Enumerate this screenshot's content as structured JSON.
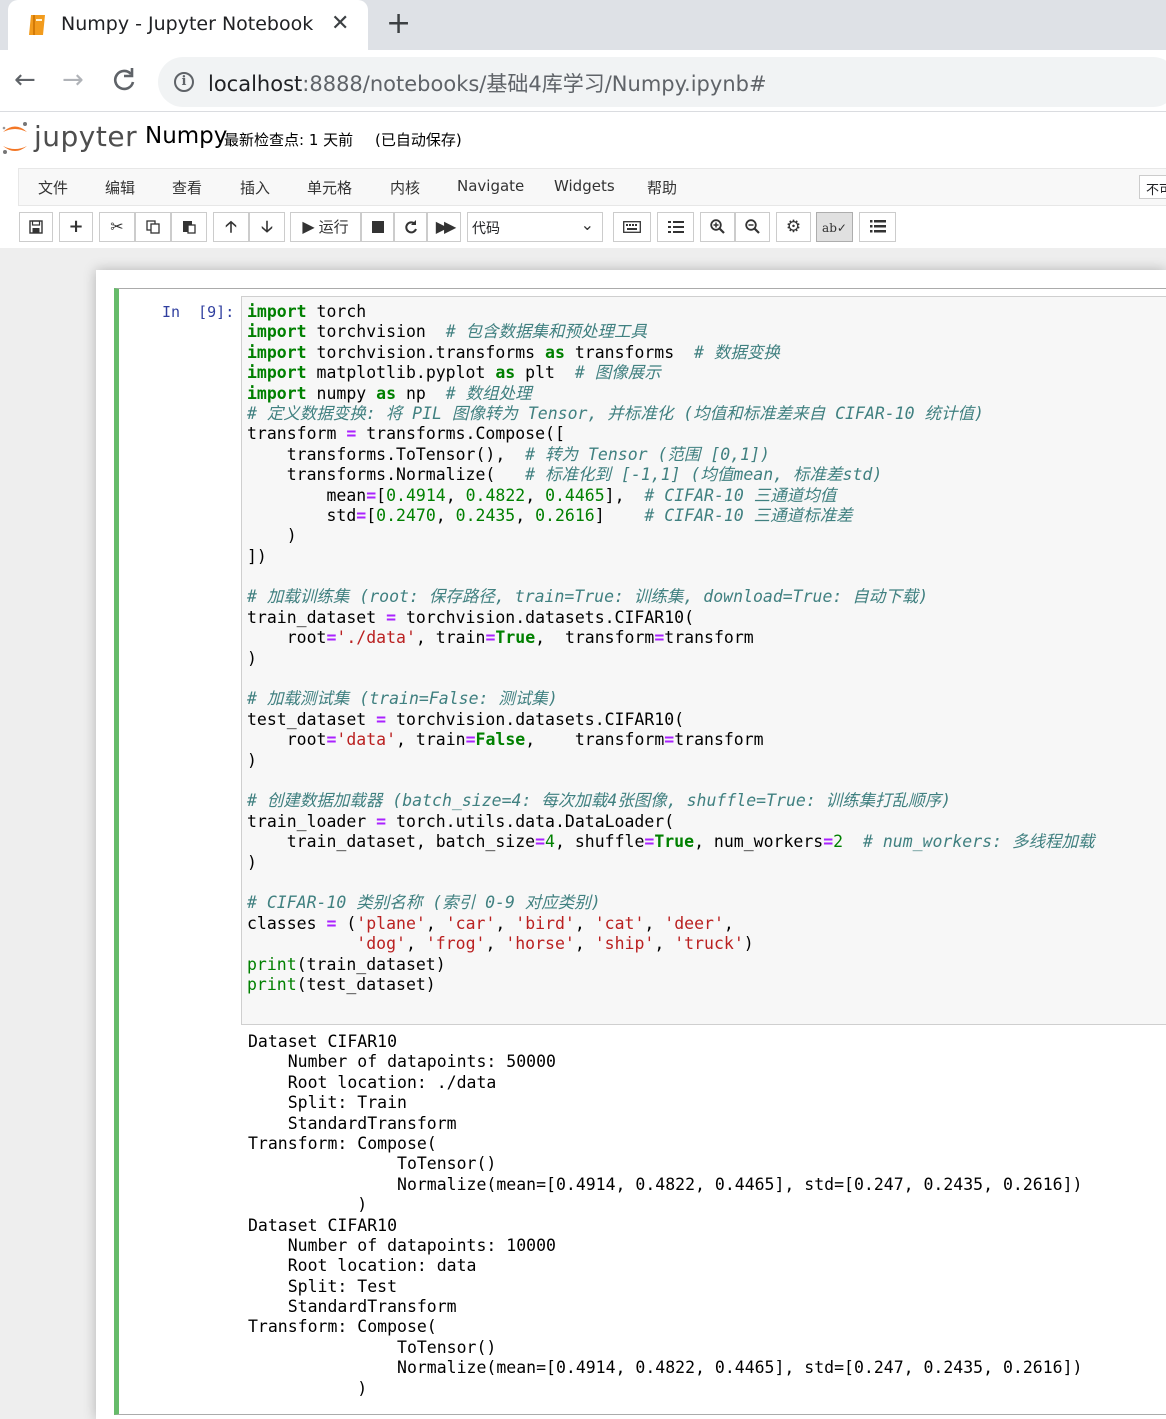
{
  "browser": {
    "tab_title": "Numpy - Jupyter Notebook",
    "close_glyph": "✕",
    "newtab_glyph": "+",
    "url_host": "localhost",
    "url_rest": ":8888/notebooks/基础4库学习/Numpy.ipynb#"
  },
  "jupyter": {
    "wordmark": "jupyter",
    "notebook_name": "Numpy",
    "checkpoint": "最新检查点: 1 天前",
    "autosave": "(已自动保存)",
    "menu": [
      "文件",
      "编辑",
      "查看",
      "插入",
      "单元格",
      "内核",
      "Navigate",
      "Widgets",
      "帮助"
    ],
    "kernel_indicator": "不可",
    "toolbar": {
      "run_label": "运行",
      "cell_type": "代码"
    }
  },
  "cell": {
    "prompt": "In  [9]:",
    "code_lines": [
      [
        [
          "kw",
          "import"
        ],
        [
          "pl",
          " torch"
        ]
      ],
      [
        [
          "kw",
          "import"
        ],
        [
          "pl",
          " torchvision  "
        ],
        [
          "cm",
          "# 包含数据集和预处理工具"
        ]
      ],
      [
        [
          "kw",
          "import"
        ],
        [
          "pl",
          " torchvision.transforms "
        ],
        [
          "kw",
          "as"
        ],
        [
          "pl",
          " transforms  "
        ],
        [
          "cm",
          "# 数据变换"
        ]
      ],
      [
        [
          "kw",
          "import"
        ],
        [
          "pl",
          " matplotlib.pyplot "
        ],
        [
          "kw",
          "as"
        ],
        [
          "pl",
          " plt  "
        ],
        [
          "cm",
          "# 图像展示"
        ]
      ],
      [
        [
          "kw",
          "import"
        ],
        [
          "pl",
          " numpy "
        ],
        [
          "kw",
          "as"
        ],
        [
          "pl",
          " np  "
        ],
        [
          "cm",
          "# 数组处理"
        ]
      ],
      [
        [
          "cm",
          "# 定义数据变换: 将 PIL 图像转为 Tensor, 并标准化 (均值和标准差来自 CIFAR-10 统计值)"
        ]
      ],
      [
        [
          "pl",
          "transform "
        ],
        [
          "op",
          "="
        ],
        [
          "pl",
          " transforms.Compose(["
        ]
      ],
      [
        [
          "pl",
          "    transforms.ToTensor(),  "
        ],
        [
          "cm",
          "# 转为 Tensor (范围 [0,1])"
        ]
      ],
      [
        [
          "pl",
          "    transforms.Normalize(   "
        ],
        [
          "cm",
          "# 标准化到 [-1,1] (均值mean, 标准差std)"
        ]
      ],
      [
        [
          "pl",
          "        mean"
        ],
        [
          "op",
          "="
        ],
        [
          "pl",
          "["
        ],
        [
          "nm",
          "0.4914"
        ],
        [
          "pl",
          ", "
        ],
        [
          "nm",
          "0.4822"
        ],
        [
          "pl",
          ", "
        ],
        [
          "nm",
          "0.4465"
        ],
        [
          "pl",
          "],  "
        ],
        [
          "cm",
          "# CIFAR-10 三通道均值"
        ]
      ],
      [
        [
          "pl",
          "        std"
        ],
        [
          "op",
          "="
        ],
        [
          "pl",
          "["
        ],
        [
          "nm",
          "0.2470"
        ],
        [
          "pl",
          ", "
        ],
        [
          "nm",
          "0.2435"
        ],
        [
          "pl",
          ", "
        ],
        [
          "nm",
          "0.2616"
        ],
        [
          "pl",
          "]    "
        ],
        [
          "cm",
          "# CIFAR-10 三通道标准差"
        ]
      ],
      [
        [
          "pl",
          "    )"
        ]
      ],
      [
        [
          "pl",
          "])"
        ]
      ],
      [
        [
          "pl",
          ""
        ]
      ],
      [
        [
          "cm",
          "# 加载训练集 (root: 保存路径, train=True: 训练集, download=True: 自动下载)"
        ]
      ],
      [
        [
          "pl",
          "train_dataset "
        ],
        [
          "op",
          "="
        ],
        [
          "pl",
          " torchvision.datasets.CIFAR10("
        ]
      ],
      [
        [
          "pl",
          "    root"
        ],
        [
          "op",
          "="
        ],
        [
          "st",
          "'./data'"
        ],
        [
          "pl",
          ", train"
        ],
        [
          "op",
          "="
        ],
        [
          "kw",
          "True"
        ],
        [
          "pl",
          ",  transform"
        ],
        [
          "op",
          "="
        ],
        [
          "pl",
          "transform"
        ]
      ],
      [
        [
          "pl",
          ")"
        ]
      ],
      [
        [
          "pl",
          ""
        ]
      ],
      [
        [
          "cm",
          "# 加载测试集 (train=False: 测试集)"
        ]
      ],
      [
        [
          "pl",
          "test_dataset "
        ],
        [
          "op",
          "="
        ],
        [
          "pl",
          " torchvision.datasets.CIFAR10("
        ]
      ],
      [
        [
          "pl",
          "    root"
        ],
        [
          "op",
          "="
        ],
        [
          "st",
          "'data'"
        ],
        [
          "pl",
          ", train"
        ],
        [
          "op",
          "="
        ],
        [
          "kw",
          "False"
        ],
        [
          "pl",
          ",    transform"
        ],
        [
          "op",
          "="
        ],
        [
          "pl",
          "transform"
        ]
      ],
      [
        [
          "pl",
          ")"
        ]
      ],
      [
        [
          "pl",
          ""
        ]
      ],
      [
        [
          "cm",
          "# 创建数据加载器 (batch_size=4: 每次加载4张图像, shuffle=True: 训练集打乱顺序)"
        ]
      ],
      [
        [
          "pl",
          "train_loader "
        ],
        [
          "op",
          "="
        ],
        [
          "pl",
          " torch.utils.data.DataLoader("
        ]
      ],
      [
        [
          "pl",
          "    train_dataset, batch_size"
        ],
        [
          "op",
          "="
        ],
        [
          "nm",
          "4"
        ],
        [
          "pl",
          ", shuffle"
        ],
        [
          "op",
          "="
        ],
        [
          "kw",
          "True"
        ],
        [
          "pl",
          ", num_workers"
        ],
        [
          "op",
          "="
        ],
        [
          "nm",
          "2"
        ],
        [
          "pl",
          "  "
        ],
        [
          "cm",
          "# num_workers: 多线程加载"
        ]
      ],
      [
        [
          "pl",
          ")"
        ]
      ],
      [
        [
          "pl",
          ""
        ]
      ],
      [
        [
          "cm",
          "# CIFAR-10 类别名称 (索引 0-9 对应类别)"
        ]
      ],
      [
        [
          "pl",
          "classes "
        ],
        [
          "op",
          "="
        ],
        [
          "pl",
          " ("
        ],
        [
          "st",
          "'plane'"
        ],
        [
          "pl",
          ", "
        ],
        [
          "st",
          "'car'"
        ],
        [
          "pl",
          ", "
        ],
        [
          "st",
          "'bird'"
        ],
        [
          "pl",
          ", "
        ],
        [
          "st",
          "'cat'"
        ],
        [
          "pl",
          ", "
        ],
        [
          "st",
          "'deer'"
        ],
        [
          "pl",
          ","
        ]
      ],
      [
        [
          "pl",
          "           "
        ],
        [
          "st",
          "'dog'"
        ],
        [
          "pl",
          ", "
        ],
        [
          "st",
          "'frog'"
        ],
        [
          "pl",
          ", "
        ],
        [
          "st",
          "'horse'"
        ],
        [
          "pl",
          ", "
        ],
        [
          "st",
          "'ship'"
        ],
        [
          "pl",
          ", "
        ],
        [
          "st",
          "'truck'"
        ],
        [
          "pl",
          ")"
        ]
      ],
      [
        [
          "bi",
          "print"
        ],
        [
          "pl",
          "(train_dataset)"
        ]
      ],
      [
        [
          "bi",
          "print"
        ],
        [
          "pl",
          "(test_dataset)"
        ]
      ]
    ],
    "output_lines": [
      "Dataset CIFAR10",
      "    Number of datapoints: 50000",
      "    Root location: ./data",
      "    Split: Train",
      "    StandardTransform",
      "Transform: Compose(",
      "               ToTensor()",
      "               Normalize(mean=[0.4914, 0.4822, 0.4465], std=[0.247, 0.2435, 0.2616])",
      "           )",
      "Dataset CIFAR10",
      "    Number of datapoints: 10000",
      "    Root location: data",
      "    Split: Test",
      "    StandardTransform",
      "Transform: Compose(",
      "               ToTensor()",
      "               Normalize(mean=[0.4914, 0.4822, 0.4465], std=[0.247, 0.2435, 0.2616])",
      "           )"
    ]
  },
  "colors": {
    "cell_border_active": "#66bb6a",
    "prompt": "#303f9f",
    "keyword": "#008000",
    "comment": "#408080",
    "string": "#ba2121",
    "operator": "#aa22ff"
  }
}
